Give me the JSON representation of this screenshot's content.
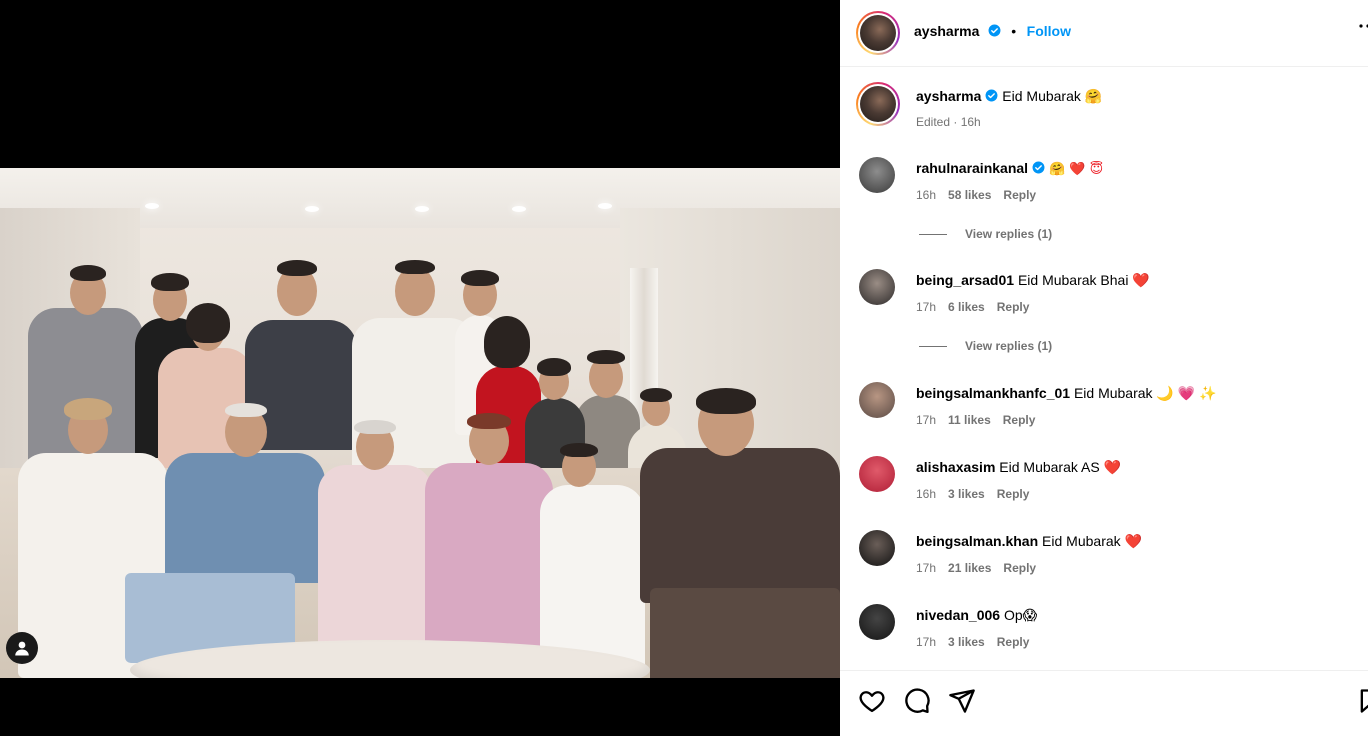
{
  "post": {
    "author": "aysharma",
    "follow_label": "Follow",
    "separator": "•",
    "caption": "Eid Mubarak 🤗",
    "caption_meta": "Edited · 16h"
  },
  "comments": [
    {
      "user": "rahulnarainkanal",
      "verified": true,
      "text": "🤗 ❤️ 😇",
      "time": "16h",
      "likes": "58 likes",
      "reply": "Reply",
      "view_replies": "View replies (1)"
    },
    {
      "user": "being_arsad01",
      "verified": false,
      "text": "Eid Mubarak Bhai ❤️",
      "time": "17h",
      "likes": "6 likes",
      "reply": "Reply",
      "view_replies": "View replies (1)"
    },
    {
      "user": "beingsalmankhanfc_01",
      "verified": false,
      "text": "Eid Mubarak 🌙 💗 ✨",
      "time": "17h",
      "likes": "11 likes",
      "reply": "Reply"
    },
    {
      "user": "alishaxasim",
      "verified": false,
      "text": "Eid Mubarak AS ❤️",
      "time": "16h",
      "likes": "3 likes",
      "reply": "Reply"
    },
    {
      "user": "beingsalman.khan",
      "verified": false,
      "text": "Eid Mubarak ❤️",
      "time": "17h",
      "likes": "21 likes",
      "reply": "Reply"
    },
    {
      "user": "nivedan_006",
      "verified": false,
      "text": "Op😱",
      "time": "17h",
      "likes": "3 likes",
      "reply": "Reply"
    }
  ],
  "icons": {
    "like": "heart-icon",
    "comment": "comment-icon",
    "share": "share-icon",
    "save": "bookmark-icon",
    "more": "more-options-icon",
    "tagged": "user-tag-icon"
  },
  "colors": {
    "link": "#0095f6",
    "verified": "#0095f6",
    "muted": "#737373"
  }
}
